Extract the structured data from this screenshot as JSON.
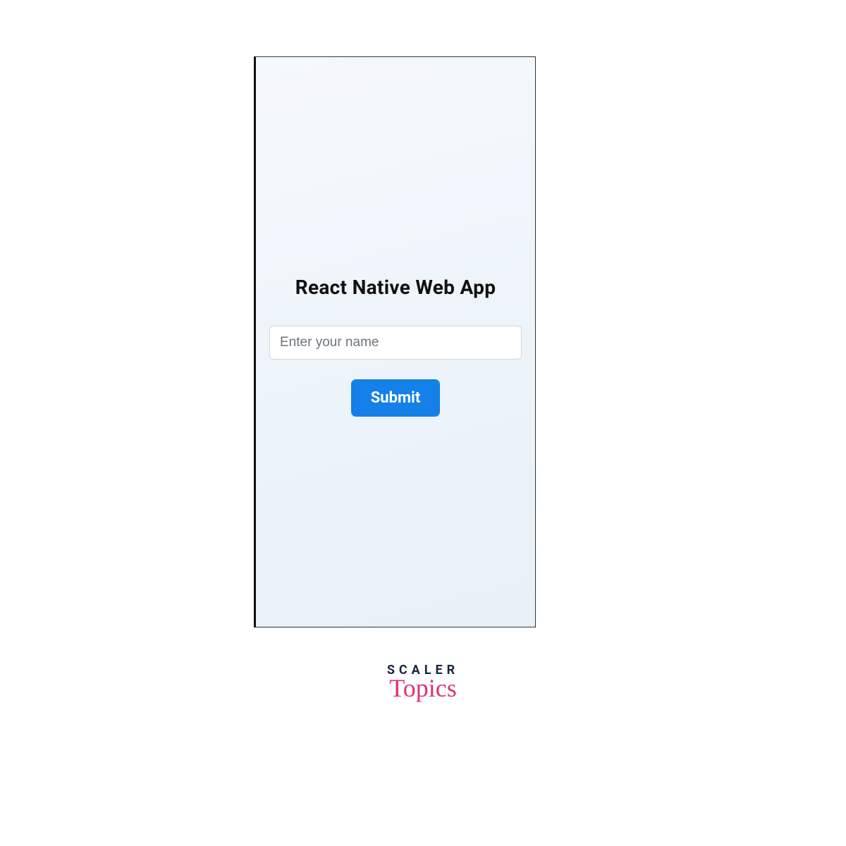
{
  "app": {
    "title": "React Native Web App",
    "name_input": {
      "placeholder": "Enter your name",
      "value": ""
    },
    "submit_label": "Submit"
  },
  "branding": {
    "logo_top": "SCALER",
    "logo_bottom": "Topics"
  },
  "colors": {
    "button_bg": "#1480e8",
    "button_text": "#ffffff",
    "logo_top": "#1a2440",
    "logo_bottom": "#e03175"
  }
}
